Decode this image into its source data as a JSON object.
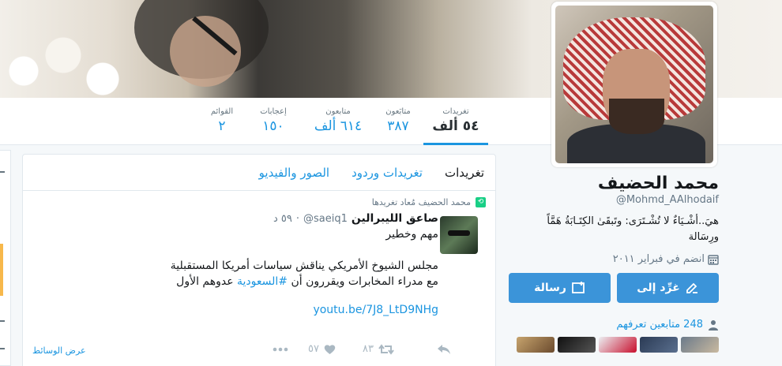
{
  "nav": {
    "items": [
      {
        "label": "تغريدات",
        "value": "٥٤ ألف"
      },
      {
        "label": "متابَعون",
        "value": "٣٨٧"
      },
      {
        "label": "متابعون",
        "value": "٦١٤ ألف"
      },
      {
        "label": "إعجابات",
        "value": "١٥٠"
      },
      {
        "label": "القوائم",
        "value": "٢"
      }
    ]
  },
  "profile": {
    "name": "محمد الحضيف",
    "handle": "@Mohmd_AAlhodaif",
    "bio_line1": "هيَ..أشْـيَاءٌ لا تُشْـتَرَى: وتَبقَىٰ الكِتَـابَةُ هَمَّاً",
    "bio_line2": "ورِسَالة",
    "joined": "انضم في فبراير ٢٠١١",
    "tweet_to_label": "غرِّد إلى",
    "message_label": "رسالة",
    "followers_you_know": "248 متابعين تعرفهم"
  },
  "timeline": {
    "tabs": [
      "تغريدات",
      "تغريدات وردود",
      "الصور والفيديو"
    ],
    "tweet": {
      "retweet_context": "محمد الحضيف مُعاد تغريدها",
      "name": "صاعق الليبرالين",
      "handle": "@saeiq1",
      "time": "٥٩ د",
      "line1": "مهم وخطير",
      "line2": "مجلس الشيوخ الأمريكي يناقش سياسات أمريكا المستقبلية",
      "line3_pre": "مع مدراء المخابرات ويقررون أن ",
      "hashtag": "#السعودية",
      "line3_post": " عدوهم الأول",
      "link": "youtu.be/7J8_LtD9NHg",
      "retweets": "٨٣",
      "likes": "٥٧",
      "media_label": "عرض الوسائط"
    }
  },
  "colors": {
    "accent": "#1b95e0",
    "button": "#3b94d9"
  }
}
